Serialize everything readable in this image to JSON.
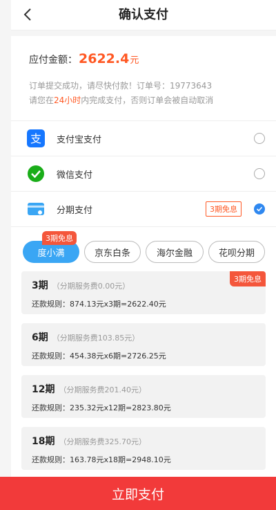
{
  "header": {
    "title": "确认支付"
  },
  "amount": {
    "label": "应付金额：",
    "value": "2622.4",
    "unit": "元"
  },
  "notice": {
    "line1": "订单提交成功，请尽快付款！订单号：19773643",
    "line2_pre": "请您在",
    "line2_hl": "24小时",
    "line2_post": "内完成支付，否则订单会被自动取消"
  },
  "payment_methods": [
    {
      "label": "支付宝支付",
      "icon": "alipay-icon",
      "selected": false
    },
    {
      "label": "微信支付",
      "icon": "wechat-pay-icon",
      "selected": false
    },
    {
      "label": "分期支付",
      "icon": "installment-card-icon",
      "selected": true,
      "badge": "3期免息"
    }
  ],
  "installment_tabs": {
    "badge": "3期免息",
    "items": [
      "度小满",
      "京东白条",
      "海尔金融",
      "花呗分期"
    ],
    "active_index": 0
  },
  "plans": [
    {
      "period": "3期",
      "fee": "（分期服务费0.00元）",
      "rule": "还款规则：874.13元x3期=2622.40元",
      "badge": "3期免息"
    },
    {
      "period": "6期",
      "fee": "（分期服务费103.85元）",
      "rule": "还款规则：454.38元x6期=2726.25元"
    },
    {
      "period": "12期",
      "fee": "（分期服务费201.40元）",
      "rule": "还款规则：235.32元x12期=2823.80元"
    },
    {
      "period": "18期",
      "fee": "（分期服务费325.70元）",
      "rule": "还款规则：163.78元x18期=2948.10元"
    }
  ],
  "colors": {
    "accent": "#ff5722",
    "primary_blue": "#2f88f0",
    "submit_red": "#f23a3a"
  },
  "submit": {
    "label": "立即支付"
  }
}
